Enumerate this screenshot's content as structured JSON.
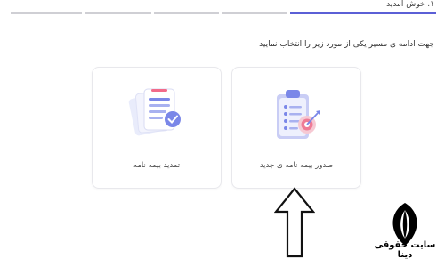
{
  "wizard": {
    "step_label": "۱. خوش آمدید",
    "steps_total": 5,
    "active_step": 1,
    "active_color": "#5b5fd6",
    "inactive_color": "#cfcfd4"
  },
  "instruction": "جهت ادامه ی مسیر یکی از مورد زیر را انتخاب نمایید",
  "options": [
    {
      "label": "صدور بیمه نامه ی جدید",
      "icon": "clipboard-target-icon"
    },
    {
      "label": "تمدید بیمه نامه",
      "icon": "documents-check-icon"
    }
  ],
  "watermark": {
    "text": "سایت حقوقی دینا"
  }
}
